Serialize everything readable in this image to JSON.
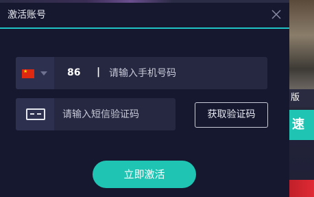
{
  "dialog": {
    "title": "激活账号",
    "accent_color": "#1fc4c6",
    "background_color": "#161830"
  },
  "phone_row": {
    "country_flag": "cn-flag-icon",
    "country_code": "86",
    "separator": "|",
    "phone_input": {
      "value": "",
      "placeholder": "请输入手机号码"
    }
  },
  "code_row": {
    "icon": "password-box-icon",
    "code_input": {
      "value": "",
      "placeholder": "请输入短信验证码"
    },
    "get_code_label": "获取验证码"
  },
  "actions": {
    "activate_label": "立即激活",
    "activate_color": "#1fc4b3"
  },
  "background_app": {
    "ban_text": "版",
    "speed_text": "速"
  }
}
